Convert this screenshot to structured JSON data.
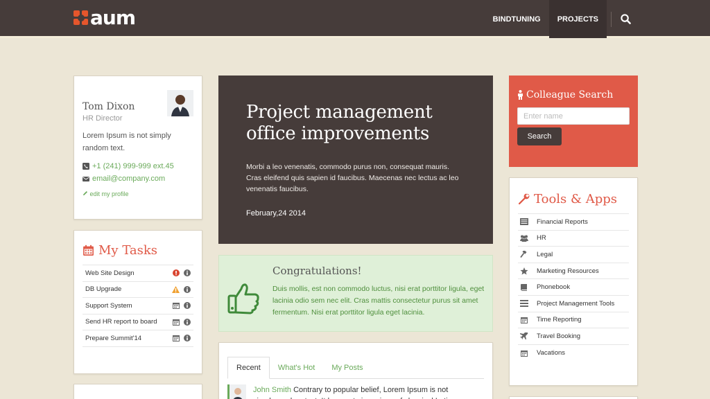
{
  "header": {
    "brand": "aum",
    "nav": [
      {
        "label": "BINDTUNING"
      },
      {
        "label": "PROJECTS"
      }
    ],
    "colors": {
      "bar": "#463c3a",
      "accent": "#e5562c"
    }
  },
  "profile": {
    "name": "Tom Dixon",
    "role": "HR Director",
    "bio": "Lorem Ipsum is not simply random text.",
    "phone": "+1 (241) 999-999 ext.45",
    "email": "email@company.com",
    "edit_link": "edit my profile"
  },
  "tasks": {
    "title": "My Tasks",
    "items": [
      {
        "label": "Web Site Design",
        "status_icon": "exclamation-circle-icon"
      },
      {
        "label": "DB Upgrade",
        "status_icon": "warning-triangle-icon"
      },
      {
        "label": "Support System",
        "status_icon": "calendar-icon"
      },
      {
        "label": "Send HR report to board",
        "status_icon": "calendar-icon"
      },
      {
        "label": "Prepare Summit'14",
        "status_icon": "calendar-icon"
      }
    ]
  },
  "hero": {
    "title": "Project management office improvements",
    "lead": "Morbi a leo venenatis, commodo purus non, consequat mauris. Cras eleifend quis sapien id faucibus. Maecenas nec lectus ac leo venenatis faucibus.",
    "date": "February,24 2014"
  },
  "congrats": {
    "title": "Congratulations!",
    "text": "Duis mollis, est non commodo luctus, nisi erat porttitor ligula, eget lacinia odio sem nec elit. Cras mattis consectetur purus sit amet fermentum. Nisi erat porttitor ligula eget lacinia."
  },
  "feed": {
    "tabs": [
      {
        "label": "Recent"
      },
      {
        "label": "What's Hot"
      },
      {
        "label": "My Posts"
      }
    ],
    "item": {
      "author": "John Smith",
      "text": "Contrary to popular belief, Lorem Ipsum is not simply random text. It has roots in a piece of classical Latin"
    }
  },
  "colleague_search": {
    "title": "Colleague Search",
    "placeholder": "Enter name",
    "button": "Search"
  },
  "tools": {
    "title": "Tools & Apps",
    "items": [
      {
        "label": "Financial Reports",
        "icon": "report-icon"
      },
      {
        "label": "HR",
        "icon": "users-icon"
      },
      {
        "label": "Legal",
        "icon": "gavel-icon"
      },
      {
        "label": "Marketing Resources",
        "icon": "star-icon"
      },
      {
        "label": "Phonebook",
        "icon": "book-icon"
      },
      {
        "label": "Project Management Tools",
        "icon": "list-icon"
      },
      {
        "label": "Time Reporting",
        "icon": "calendar-icon"
      },
      {
        "label": "Travel Booking",
        "icon": "plane-icon"
      },
      {
        "label": "Vacations",
        "icon": "calendar-icon"
      }
    ]
  }
}
